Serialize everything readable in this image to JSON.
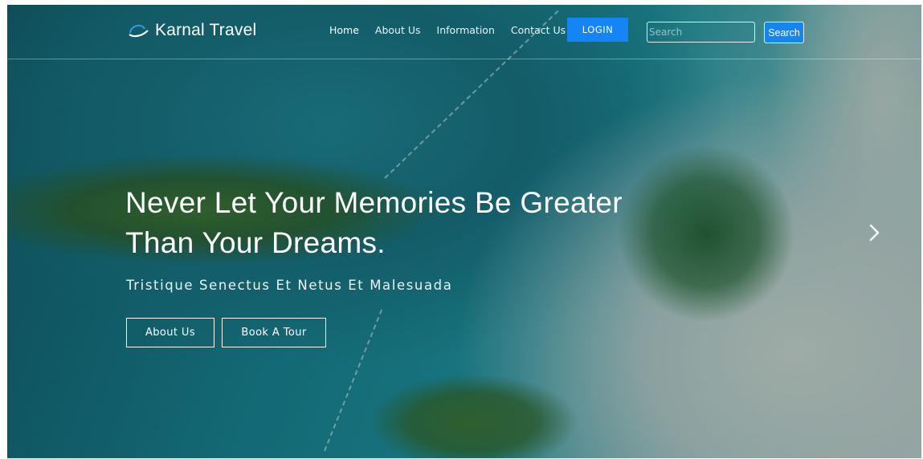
{
  "brand": {
    "name": "Karnal Travel",
    "icon": "swoosh-logo-icon"
  },
  "nav": {
    "links": [
      {
        "label": "Home",
        "active": true
      },
      {
        "label": "About Us",
        "active": false
      },
      {
        "label": "Information",
        "active": false
      },
      {
        "label": "Contact Us",
        "active": false
      }
    ],
    "login_label": "LOGIN",
    "search_placeholder": "Search",
    "search_value": "",
    "search_button_label": "Search"
  },
  "hero": {
    "headline": "Never Let Your Memories Be Greater Than Your Dreams.",
    "subtitle": "Tristique Senectus Et Netus Et Malesuada",
    "buttons": {
      "about": "About Us",
      "tour": "Book A Tour"
    },
    "next_icon": "chevron-right-icon"
  },
  "colors": {
    "accent": "#1585f5",
    "text": "#ffffff"
  }
}
